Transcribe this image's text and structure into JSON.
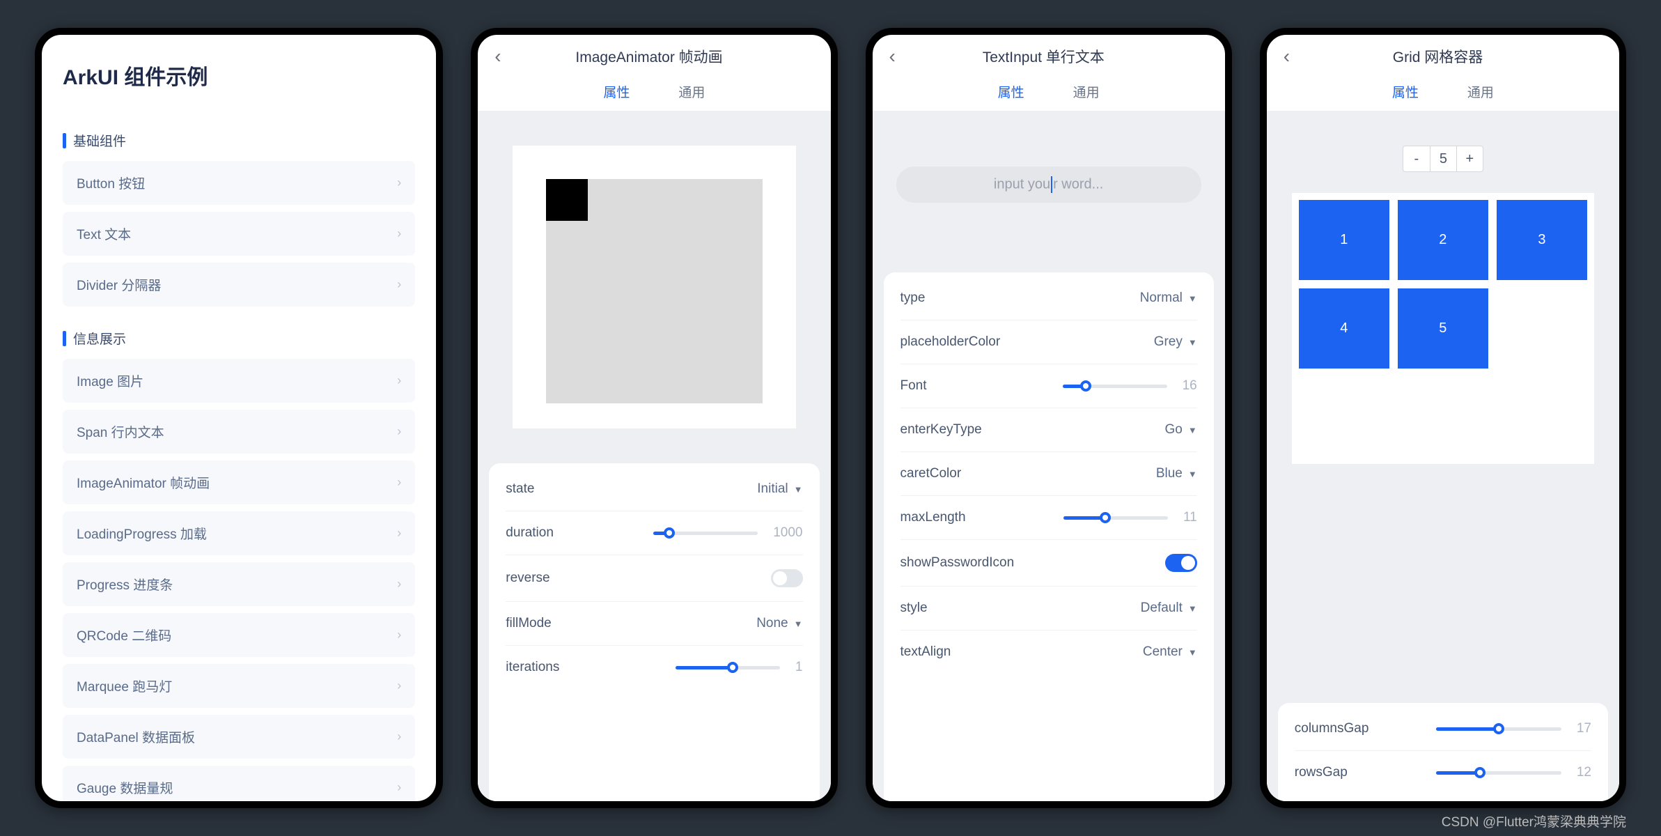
{
  "watermark": "CSDN @Flutter鸿蒙梁典典学院",
  "phone1": {
    "title": "ArkUI 组件示例",
    "section1": "基础组件",
    "items1": [
      "Button 按钮",
      "Text 文本",
      "Divider 分隔器"
    ],
    "section2": "信息展示",
    "items2": [
      "Image 图片",
      "Span 行内文本",
      "ImageAnimator 帧动画",
      "LoadingProgress 加载",
      "Progress 进度条",
      "QRCode 二维码",
      "Marquee 跑马灯",
      "DataPanel 数据面板",
      "Gauge 数据量规"
    ]
  },
  "phone2": {
    "title": "ImageAnimator 帧动画",
    "tab1": "属性",
    "tab2": "通用",
    "rows": {
      "state": {
        "label": "state",
        "value": "Initial"
      },
      "duration": {
        "label": "duration",
        "value": "1000",
        "pct": 15
      },
      "reverse": {
        "label": "reverse",
        "on": false
      },
      "fillMode": {
        "label": "fillMode",
        "value": "None"
      },
      "iterations": {
        "label": "iterations",
        "value": "1",
        "pct": 55
      }
    }
  },
  "phone3": {
    "title": "TextInput 单行文本",
    "tab1": "属性",
    "tab2": "通用",
    "placeholder_pre": "input you",
    "placeholder_post": "r word...",
    "rows": {
      "type": {
        "label": "type",
        "value": "Normal"
      },
      "placeholderColor": {
        "label": "placeholderColor",
        "value": "Grey"
      },
      "font": {
        "label": "Font",
        "value": "16",
        "pct": 22
      },
      "enterKeyType": {
        "label": "enterKeyType",
        "value": "Go"
      },
      "caretColor": {
        "label": "caretColor",
        "value": "Blue"
      },
      "maxLength": {
        "label": "maxLength",
        "value": "11",
        "pct": 40
      },
      "showPasswordIcon": {
        "label": "showPasswordIcon",
        "on": true
      },
      "style": {
        "label": "style",
        "value": "Default"
      },
      "textAlign": {
        "label": "textAlign",
        "value": "Center"
      }
    }
  },
  "phone4": {
    "title": "Grid 网格容器",
    "tab1": "属性",
    "tab2": "通用",
    "stepper": {
      "minus": "-",
      "value": "5",
      "plus": "+"
    },
    "cells": [
      "1",
      "2",
      "3",
      "4",
      "5"
    ],
    "rows": {
      "columnsGap": {
        "label": "columnsGap",
        "value": "17",
        "pct": 50
      },
      "rowsGap": {
        "label": "rowsGap",
        "value": "12",
        "pct": 35
      }
    }
  }
}
